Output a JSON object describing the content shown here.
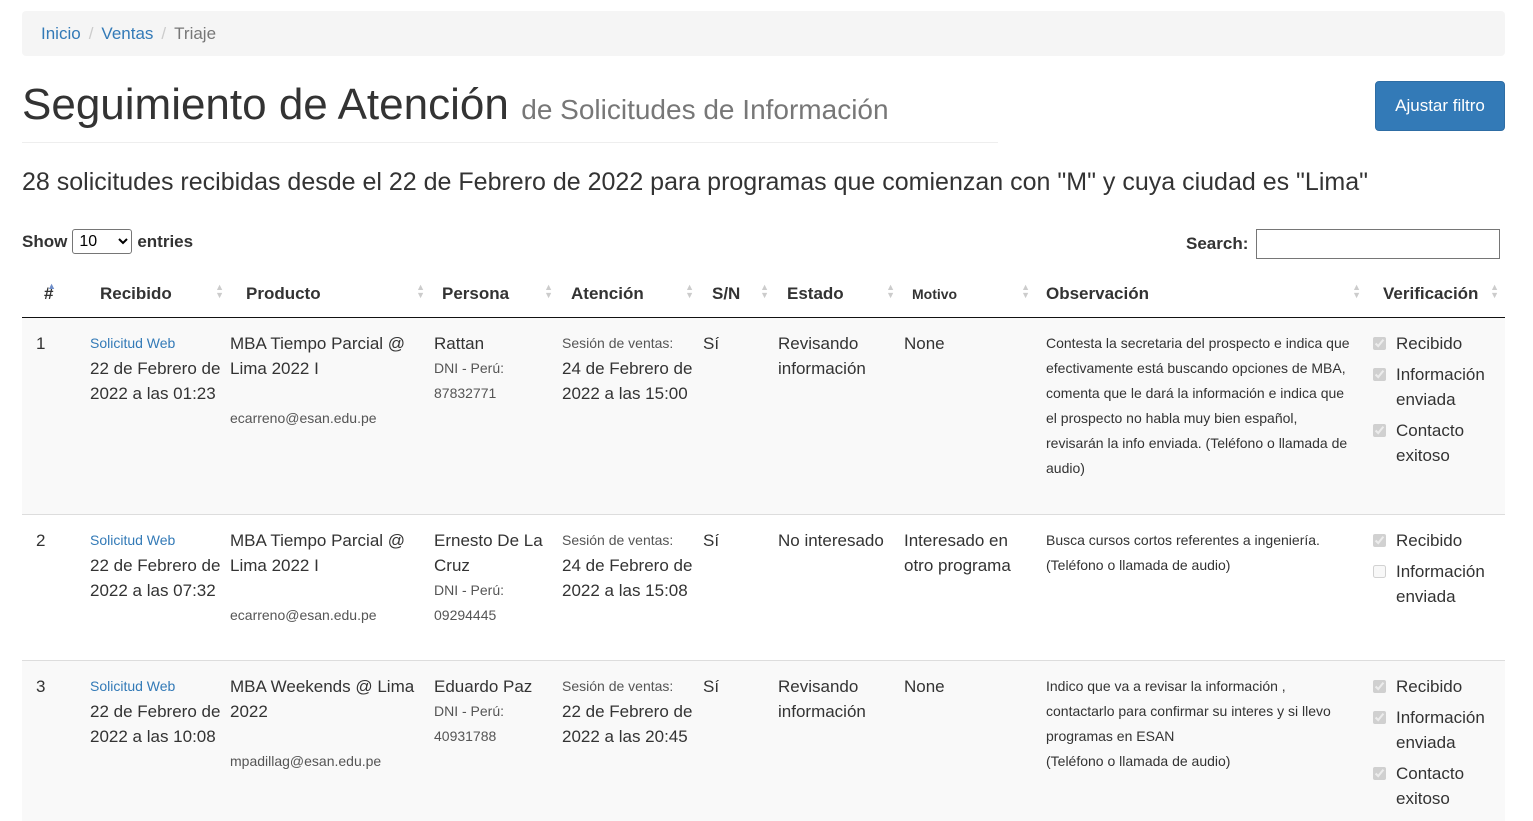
{
  "breadcrumb": {
    "home": "Inicio",
    "sales": "Ventas",
    "current": "Triaje"
  },
  "header": {
    "title": "Seguimiento de Atención",
    "subtitle": "de Solicitudes de Información",
    "filter_button": "Ajustar filtro"
  },
  "summary": "28 solicitudes recibidas desde el 22 de Febrero de 2022 para programas que comienzan con \"M\" y cuya ciudad es \"Lima\"",
  "length": {
    "show": "Show",
    "entries": "entries",
    "selected": "10"
  },
  "search": {
    "label": "Search:"
  },
  "columns": [
    "#",
    "Recibido",
    "Producto",
    "Persona",
    "Atención",
    "S/N",
    "Estado",
    "Motivo",
    "Observación",
    "Verificación"
  ],
  "rows": [
    {
      "num": "1",
      "source": "Solicitud Web",
      "received": "22 de Febrero de 2022 a las 01:23",
      "product": "MBA Tiempo Parcial @ Lima 2022 I",
      "email": "ecarreno@esan.edu.pe",
      "person": "Rattan",
      "doc": "DNI - Perú: 87832771",
      "session_label": "Sesión de ventas:",
      "attention": "24 de Febrero de 2022 a las 15:00",
      "sn": "Sí",
      "status": "Revisando información",
      "reason": "None",
      "observation": "Contesta la secretaria del prospecto e indica que efectivamente está buscando opciones de MBA, comenta que le dará la información e indica que el prospecto no habla muy bien español, revisarán la info enviada. (Teléfono o llamada de audio)",
      "checks": [
        {
          "label": "Recibido",
          "checked": true
        },
        {
          "label": "Información enviada",
          "checked": true
        },
        {
          "label": "Contacto exitoso",
          "checked": true
        }
      ]
    },
    {
      "num": "2",
      "source": "Solicitud Web",
      "received": "22 de Febrero de 2022 a las 07:32",
      "product": "MBA Tiempo Parcial @ Lima 2022 I",
      "email": "ecarreno@esan.edu.pe",
      "person": "Ernesto De La Cruz",
      "doc": "DNI - Perú: 09294445",
      "session_label": "Sesión de ventas:",
      "attention": "24 de Febrero de 2022 a las 15:08",
      "sn": "Sí",
      "status": "No interesado",
      "reason": "Interesado en otro programa",
      "observation": "Busca cursos cortos referentes a ingeniería. (Teléfono o llamada de audio)",
      "checks": [
        {
          "label": "Recibido",
          "checked": true
        },
        {
          "label": "Información enviada",
          "checked": false
        }
      ]
    },
    {
      "num": "3",
      "source": "Solicitud Web",
      "received": "22 de Febrero de 2022 a las 10:08",
      "product": "MBA Weekends @ Lima 2022",
      "email": "mpadillag@esan.edu.pe",
      "person": "Eduardo Paz",
      "doc": "DNI - Perú: 40931788",
      "session_label": "Sesión de ventas:",
      "attention": "22 de Febrero de 2022 a las 20:45",
      "sn": "Sí",
      "status": "Revisando información",
      "reason": "None",
      "observation": "Indico que va a revisar la información , contactarlo para confirmar su interes y si llevo programas en ESAN",
      "observation2": "(Teléfono o llamada de audio)",
      "checks": [
        {
          "label": "Recibido",
          "checked": true
        },
        {
          "label": "Información enviada",
          "checked": true
        },
        {
          "label": "Contacto exitoso",
          "checked": true
        }
      ]
    }
  ]
}
